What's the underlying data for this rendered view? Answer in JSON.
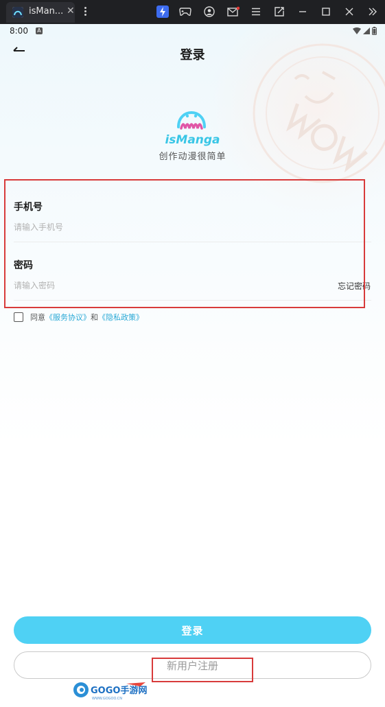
{
  "window": {
    "tab_title": "isMan...",
    "tab_close": "✕",
    "toolbar_icons": [
      "lightning-icon",
      "gamepad-icon",
      "account-icon",
      "mail-icon",
      "menu-icon",
      "popout-icon",
      "minimize-icon",
      "maximize-icon",
      "close-icon",
      "expand-icon"
    ]
  },
  "statusbar": {
    "time": "8:00",
    "notif_badge": "A"
  },
  "header": {
    "title": "登录"
  },
  "brand": {
    "name": "isManga",
    "slogan": "创作动漫很简单"
  },
  "form": {
    "phone_label": "手机号",
    "phone_placeholder": "请输入手机号",
    "password_label": "密码",
    "password_placeholder": "请输入密码",
    "forgot_label": "忘记密码"
  },
  "agreement": {
    "prefix": "同意",
    "terms": "《服务协议》",
    "and": "和",
    "privacy": "《隐私政策》",
    "checked": false
  },
  "actions": {
    "login_label": "登录",
    "register_label": "新用户注册"
  },
  "watermark": {
    "text": "GOGO手游网",
    "url": "WWW.GOGOO.CN"
  },
  "colors": {
    "accent": "#4fd1f4",
    "link": "#2aa9d6",
    "annotation": "#d83a3a",
    "titlebar": "#1f2023"
  }
}
